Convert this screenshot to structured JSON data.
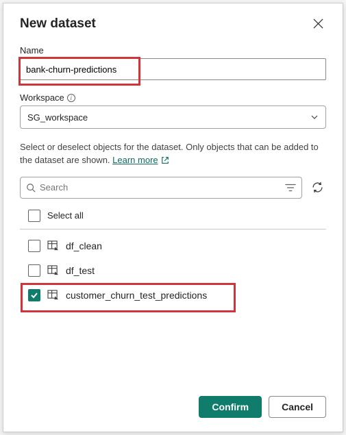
{
  "dialog": {
    "title": "New dataset"
  },
  "name": {
    "label": "Name",
    "value": "bank-churn-predictions"
  },
  "workspace": {
    "label": "Workspace",
    "value": "SG_workspace"
  },
  "help": {
    "text": "Select or deselect objects for the dataset. Only objects that can be added to the dataset are shown. ",
    "link": "Learn more "
  },
  "search": {
    "placeholder": "Search"
  },
  "select_all_label": "Select all",
  "objects": [
    {
      "label": "df_clean",
      "checked": false
    },
    {
      "label": "df_test",
      "checked": false
    },
    {
      "label": "customer_churn_test_predictions",
      "checked": true
    }
  ],
  "footer": {
    "confirm": "Confirm",
    "cancel": "Cancel"
  }
}
